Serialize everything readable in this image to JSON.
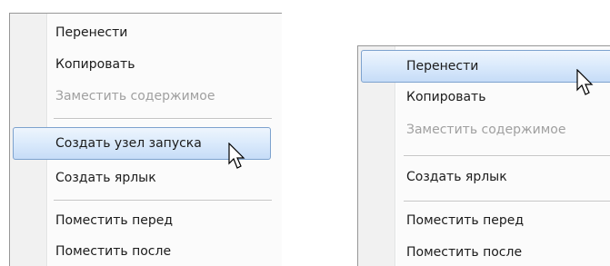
{
  "left_menu": {
    "items": [
      {
        "label": "Перенести",
        "state": "normal"
      },
      {
        "label": "Копировать",
        "state": "normal"
      },
      {
        "label": "Заместить содержимое",
        "state": "disabled"
      },
      {
        "label": "Создать узел запуска",
        "state": "selected"
      },
      {
        "label": "Создать ярлык",
        "state": "normal"
      },
      {
        "label": "Поместить перед",
        "state": "normal"
      },
      {
        "label": "Поместить после",
        "state": "normal"
      }
    ]
  },
  "right_menu": {
    "items": [
      {
        "label": "Перенести",
        "state": "selected"
      },
      {
        "label": "Копировать",
        "state": "normal"
      },
      {
        "label": "Заместить содержимое",
        "state": "disabled"
      },
      {
        "label": "Создать ярлык",
        "state": "normal"
      },
      {
        "label": "Поместить перед",
        "state": "normal"
      },
      {
        "label": "Поместить после",
        "state": "normal"
      }
    ]
  },
  "colors": {
    "selection_border": "#7da2ce",
    "selection_fill": "#dcebfc",
    "disabled_text": "#a0a0a0",
    "text": "#1b1b1b"
  },
  "icons": [
    "mouse-pointer-icon"
  ]
}
